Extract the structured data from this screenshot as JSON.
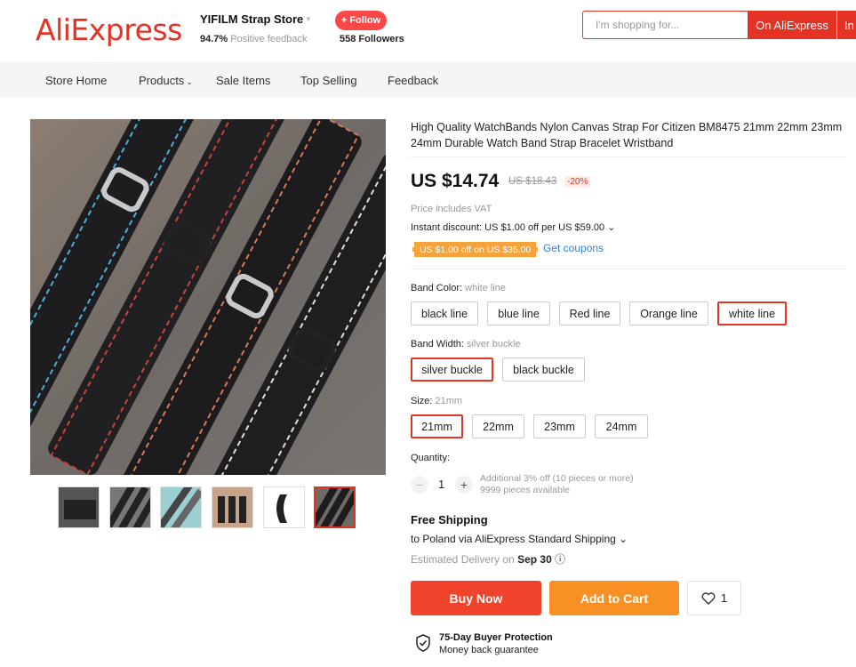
{
  "header": {
    "logo": "AliExpress",
    "store_name": "YIFILM Strap Store",
    "feedback_percent": "94.7%",
    "feedback_label": "Positive feedback",
    "follow_label": "+ Follow",
    "followers_count": "558",
    "followers_label": "Followers",
    "search_placeholder": "I'm shopping for...",
    "search_btn": "On AliExpress",
    "search_btn2": "In"
  },
  "nav": {
    "items": [
      "Store Home",
      "Products",
      "Sale Items",
      "Top Selling",
      "Feedback"
    ]
  },
  "product": {
    "title": "High Quality WatchBands Nylon Canvas Strap For Citizen BM8475 21mm 22mm 23mm 24mm Durable Watch Band Strap Bracelet Wristband",
    "price": "US $14.74",
    "old_price": "US $18.43",
    "discount": "-20%",
    "vat_note": "Price includes VAT",
    "instant_discount": "Instant discount: US $1.00 off per US $59.00",
    "coupon_tag": "US $1.00 off on US $35.00",
    "get_coupons": "Get coupons"
  },
  "options": {
    "color": {
      "label": "Band Color:",
      "selected": "white line",
      "values": [
        "black line",
        "blue line",
        "Red line",
        "Orange line",
        "white line"
      ]
    },
    "width": {
      "label": "Band Width:",
      "selected": "silver buckle",
      "values": [
        "silver buckle",
        "black buckle"
      ]
    },
    "size": {
      "label": "Size:",
      "selected": "21mm",
      "values": [
        "21mm",
        "22mm",
        "23mm",
        "24mm"
      ]
    }
  },
  "quantity": {
    "label": "Quantity:",
    "value": "1",
    "minus": "−",
    "plus": "+",
    "note1": "Additional 3% off (10 pieces or more)",
    "note2": "9999 pieces available"
  },
  "shipping": {
    "title": "Free Shipping",
    "to": "to Poland via AliExpress Standard Shipping",
    "est_label": "Estimated Delivery on",
    "est_date": "Sep 30"
  },
  "actions": {
    "buy_now": "Buy Now",
    "add_to_cart": "Add to Cart",
    "wish_count": "1"
  },
  "protection": {
    "title": "75-Day Buyer Protection",
    "subtitle": "Money back guarantee"
  },
  "colors": {
    "brand": "#e43225",
    "buy": "#f0432b",
    "cart": "#f99023",
    "link": "#2e7ed8"
  }
}
